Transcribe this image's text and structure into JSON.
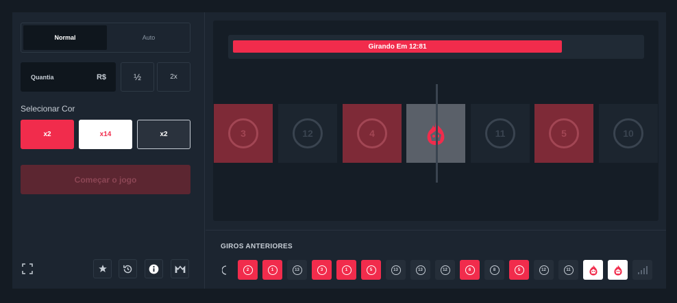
{
  "controls": {
    "mode_tabs": [
      "Normal",
      "Auto"
    ],
    "amount_label": "Quantia",
    "currency": "R$",
    "half_label": "½",
    "double_label": "2x",
    "select_color_label": "Selecionar Cor",
    "color_buttons": [
      {
        "label": "x2",
        "color": "red"
      },
      {
        "label": "x14",
        "color": "white"
      },
      {
        "label": "x2",
        "color": "black"
      }
    ],
    "start_label": "Começar o jogo",
    "footer_icons": [
      "fullscreen-icon",
      "star-icon",
      "history-icon",
      "info-icon",
      "stats-icon"
    ]
  },
  "wheel": {
    "timer_text": "Girando Em 12:81",
    "progress": 0.81,
    "tiles": [
      {
        "value": "3",
        "color": "red"
      },
      {
        "value": "12",
        "color": "black"
      },
      {
        "value": "4",
        "color": "red"
      },
      {
        "value": "",
        "color": "white"
      },
      {
        "value": "11",
        "color": "black"
      },
      {
        "value": "5",
        "color": "red"
      },
      {
        "value": "10",
        "color": "black"
      }
    ]
  },
  "history": {
    "title": "GIROS ANTERIORES",
    "items": [
      {
        "value": "2",
        "color": "red"
      },
      {
        "value": "1",
        "color": "red"
      },
      {
        "value": "13",
        "color": "black"
      },
      {
        "value": "3",
        "color": "red"
      },
      {
        "value": "1",
        "color": "red"
      },
      {
        "value": "5",
        "color": "red"
      },
      {
        "value": "13",
        "color": "black"
      },
      {
        "value": "13",
        "color": "black"
      },
      {
        "value": "12",
        "color": "black"
      },
      {
        "value": "6",
        "color": "red"
      },
      {
        "value": "8",
        "color": "black"
      },
      {
        "value": "5",
        "color": "red"
      },
      {
        "value": "12",
        "color": "black"
      },
      {
        "value": "11",
        "color": "black"
      },
      {
        "value": "",
        "color": "white"
      },
      {
        "value": "",
        "color": "white"
      }
    ]
  },
  "colors": {
    "accent": "#f12c4c",
    "panel": "#1c2530",
    "background": "#141b23"
  }
}
